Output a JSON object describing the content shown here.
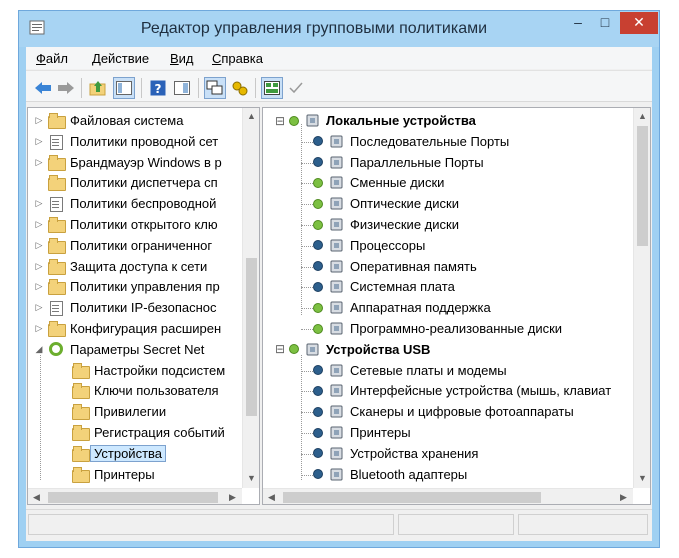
{
  "window": {
    "title": "Редактор управления групповыми политиками",
    "controls": {
      "minimize": "–",
      "maximize": "□",
      "close": "✕"
    }
  },
  "menu": [
    {
      "key": "Ф",
      "rest": "айл"
    },
    {
      "key": "Д",
      "rest": "ействие"
    },
    {
      "key": "В",
      "rest": "ид"
    },
    {
      "key": "С",
      "rest": "правка"
    }
  ],
  "toolbar": [
    "back-arrow-icon",
    "forward-arrow-icon",
    "up-folder-icon",
    "show-hide-tree-icon",
    "help-icon",
    "properties-icon",
    "new-window-icon",
    "policy-settings-icon",
    "view-pane-icon",
    "checkmark-icon"
  ],
  "left_tree": [
    {
      "label": "Файловая система",
      "icon": "folder-lock-icon",
      "expander": "▷",
      "indent": 0
    },
    {
      "label": "Политики проводной сет",
      "icon": "network-policy-icon",
      "expander": "▷",
      "indent": 0
    },
    {
      "label": "Брандмауэр Windows в р",
      "icon": "folder-icon",
      "expander": "▷",
      "indent": 0
    },
    {
      "label": "Политики диспетчера сп",
      "icon": "folder-icon",
      "expander": "",
      "indent": 0
    },
    {
      "label": "Политики беспроводной",
      "icon": "wireless-policy-icon",
      "expander": "▷",
      "indent": 0
    },
    {
      "label": "Политики открытого клю",
      "icon": "folder-icon",
      "expander": "▷",
      "indent": 0
    },
    {
      "label": "Политики ограниченног",
      "icon": "folder-icon",
      "expander": "▷",
      "indent": 0
    },
    {
      "label": "Защита доступа к сети",
      "icon": "folder-icon",
      "expander": "▷",
      "indent": 0
    },
    {
      "label": "Политики управления пр",
      "icon": "folder-icon",
      "expander": "▷",
      "indent": 0
    },
    {
      "label": "Политики IP-безопаснос",
      "icon": "ip-security-icon",
      "expander": "▷",
      "indent": 0
    },
    {
      "label": "Конфигурация расширен",
      "icon": "folder-icon",
      "expander": "▷",
      "indent": 0
    },
    {
      "label": "Параметры Secret Net",
      "icon": "secret-net-icon",
      "expander": "◢",
      "indent": 0
    },
    {
      "label": "Настройки подсистем",
      "icon": "folder-icon",
      "expander": "",
      "indent": 1
    },
    {
      "label": "Ключи пользователя",
      "icon": "folder-icon",
      "expander": "",
      "indent": 1
    },
    {
      "label": "Привилегии",
      "icon": "folder-icon",
      "expander": "",
      "indent": 1
    },
    {
      "label": "Регистрация событий",
      "icon": "folder-icon",
      "expander": "",
      "indent": 1
    },
    {
      "label": "Устройства",
      "icon": "folder-open-icon",
      "expander": "",
      "indent": 1,
      "selected": true
    },
    {
      "label": "Принтеры",
      "icon": "folder-icon",
      "expander": "",
      "indent": 1
    }
  ],
  "right_tree": [
    {
      "label": "Локальные устройства",
      "bold": true,
      "icon": "computer-icon",
      "status": "green",
      "level": 0,
      "expander": "⊟"
    },
    {
      "label": "Последовательные Порты",
      "icon": "serial-port-icon",
      "status": "info",
      "level": 1
    },
    {
      "label": "Параллельные Порты",
      "icon": "parallel-port-icon",
      "status": "info",
      "level": 1
    },
    {
      "label": "Сменные диски",
      "icon": "removable-disk-icon",
      "status": "green",
      "level": 1
    },
    {
      "label": "Оптические диски",
      "icon": "optical-disk-icon",
      "status": "green",
      "level": 1
    },
    {
      "label": "Физические диски",
      "icon": "hard-disk-icon",
      "status": "green",
      "level": 1
    },
    {
      "label": "Процессоры",
      "icon": "processor-icon",
      "status": "info",
      "level": 1
    },
    {
      "label": "Оперативная память",
      "icon": "memory-icon",
      "status": "info",
      "level": 1
    },
    {
      "label": "Системная плата",
      "icon": "motherboard-icon",
      "status": "info",
      "level": 1
    },
    {
      "label": "Аппаратная поддержка",
      "icon": "hardware-support-icon",
      "status": "green",
      "level": 1
    },
    {
      "label": "Программно-реализованные диски",
      "icon": "virtual-disk-icon",
      "status": "green",
      "level": 1
    },
    {
      "label": "Устройства USB",
      "bold": true,
      "icon": "usb-icon",
      "status": "green",
      "level": 0,
      "expander": "⊟"
    },
    {
      "label": "Сетевые платы и модемы",
      "icon": "network-card-icon",
      "status": "info",
      "level": 1
    },
    {
      "label": "Интерфейсные устройства (мышь, клавиат",
      "icon": "hid-icon",
      "status": "info",
      "level": 1
    },
    {
      "label": "Сканеры и цифровые фотоаппараты",
      "icon": "scanner-icon",
      "status": "info",
      "level": 1
    },
    {
      "label": "Принтеры",
      "icon": "printer-icon",
      "status": "info",
      "level": 1
    },
    {
      "label": "Устройства хранения",
      "icon": "storage-device-icon",
      "status": "info",
      "level": 1
    },
    {
      "label": "Bluetooth адаптеры",
      "icon": "bluetooth-icon",
      "status": "info",
      "level": 1
    }
  ],
  "colors": {
    "titlebar": "#a8d4f3",
    "close": "#c84031",
    "selection": "#cde8ff",
    "status_green": "#7cc042",
    "status_info": "#2d5f8c"
  }
}
